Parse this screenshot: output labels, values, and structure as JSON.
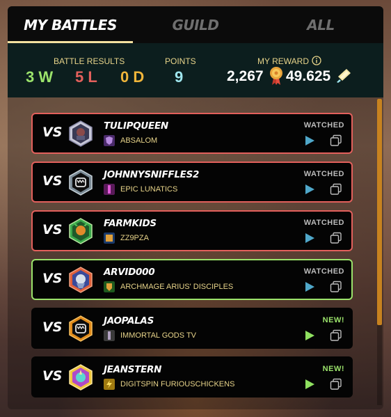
{
  "tabs": [
    {
      "label": "MY BATTLES"
    },
    {
      "label": "GUILD"
    },
    {
      "label": "ALL"
    }
  ],
  "stats": {
    "battle_results_label": "BATTLE RESULTS",
    "wins": "3 W",
    "losses": "5 L",
    "draws": "0 D",
    "points_label": "POINTS",
    "points": "9",
    "reward_label": "MY REWARD",
    "reward_merits": "2,267",
    "reward_sps": "49.625"
  },
  "colors": {
    "win": "#9be36b",
    "loss": "#e3605c",
    "draw": "#f0b53a",
    "points": "#9fe6ee",
    "label": "#e8d48a",
    "new": "#9be36b"
  },
  "battles": [
    {
      "vs": "VS",
      "opponent": "TULIPQUEEN",
      "guild": "ABSALOM",
      "status": "WATCHED",
      "result": "loss",
      "avatar_icon": "mech-robot-avatar",
      "guild_icon": "purple-crest-icon"
    },
    {
      "vs": "VS",
      "opponent": "JOHNNYSNIFFLES2",
      "guild": "EPIC LUNATICS",
      "status": "WATCHED",
      "result": "loss",
      "avatar_icon": "default-monster-avatar",
      "guild_icon": "magenta-crest-icon"
    },
    {
      "vs": "VS",
      "opponent": "FARMKIDS",
      "guild": "ZZ9PZA",
      "status": "WATCHED",
      "result": "loss",
      "avatar_icon": "goblin-avatar",
      "guild_icon": "blue-crest-icon"
    },
    {
      "vs": "VS",
      "opponent": "ARVID000",
      "guild": "ARCHMAGE ARIUS' DISCIPLES",
      "status": "WATCHED",
      "result": "win",
      "avatar_icon": "wizard-avatar",
      "guild_icon": "green-crest-icon"
    },
    {
      "vs": "VS",
      "opponent": "JAOPALAS",
      "guild": "IMMORTAL GODS TV",
      "status": "NEW!",
      "result": "new",
      "avatar_icon": "default-monster-avatar",
      "guild_icon": "grey-crest-icon"
    },
    {
      "vs": "VS",
      "opponent": "JEANSTERN",
      "guild": "DIGITSPIN FURIOUSCHICKENS",
      "status": "NEW!",
      "result": "new",
      "avatar_icon": "unicorn-avatar",
      "guild_icon": "yellow-crest-icon"
    }
  ]
}
